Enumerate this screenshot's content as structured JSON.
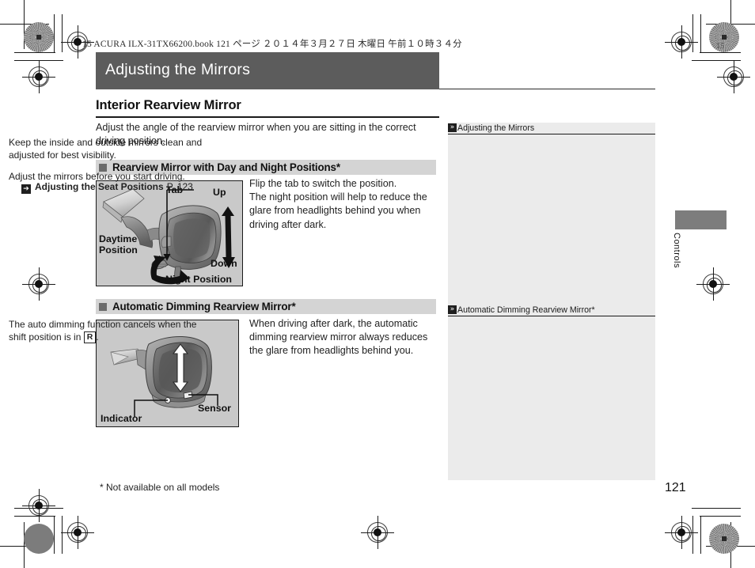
{
  "print_slug": {
    "text": "15 ACURA  ILX-31TX66200.book   121 ページ   ２０１４年３月２７日   木曜日   午前１０時３４分",
    "corner_number": "15"
  },
  "chapter": {
    "title": "Adjusting the Mirrors"
  },
  "main": {
    "section_title": "Interior Rearview Mirror",
    "intro": "Adjust the angle of the rearview mirror when you are sitting in the correct driving position.",
    "subsections": [
      {
        "heading": "Rearview Mirror with Day and Night Positions*",
        "body": "Flip the tab to switch the position.\nThe night position will help to reduce the glare from headlights behind you when driving after dark.",
        "figure": {
          "name": "rearview-mirror-day-night-illustration",
          "labels": {
            "tab": "Tab",
            "up": "Up",
            "down": "Down",
            "daytime_line1": "Daytime",
            "daytime_line2": "Position",
            "night": "Night Position"
          }
        }
      },
      {
        "heading": "Automatic Dimming Rearview Mirror*",
        "body": "When driving after dark, the automatic dimming rearview mirror always reduces the glare from headlights behind you.",
        "figure": {
          "name": "automatic-dimming-mirror-illustration",
          "labels": {
            "indicator": "Indicator",
            "sensor": "Sensor"
          }
        }
      }
    ],
    "footnote": "* Not available on all models"
  },
  "side_notes": [
    {
      "icon": "double-chevron-icon",
      "heading": "Adjusting the Mirrors",
      "paragraph1": "Keep the inside and outside mirrors clean and adjusted for best visibility.",
      "paragraph2": "Adjust the mirrors before you start driving.",
      "xref": {
        "icon": "arrow-right-icon",
        "label": "Adjusting the Seat Positions",
        "page": "P. 123"
      }
    },
    {
      "icon": "double-chevron-icon",
      "heading": "Automatic Dimming Rearview Mirror*",
      "paragraph1_before": "The auto dimming function cancels when the shift position is in ",
      "paragraph1_boxed": "R",
      "paragraph1_after": "."
    }
  ],
  "thumb_tab": {
    "label": "Controls"
  },
  "page_number": "121",
  "icons": {
    "chevron_glyph": "»",
    "arrow_glyph": "➔"
  },
  "colors": {
    "title_bar": "#5c5c5c",
    "subheading_bar": "#d4d4d4",
    "side_panel": "#ebebeb",
    "figure_bg": "#c9c9c9",
    "thumb_tab": "#7d7d7d"
  }
}
